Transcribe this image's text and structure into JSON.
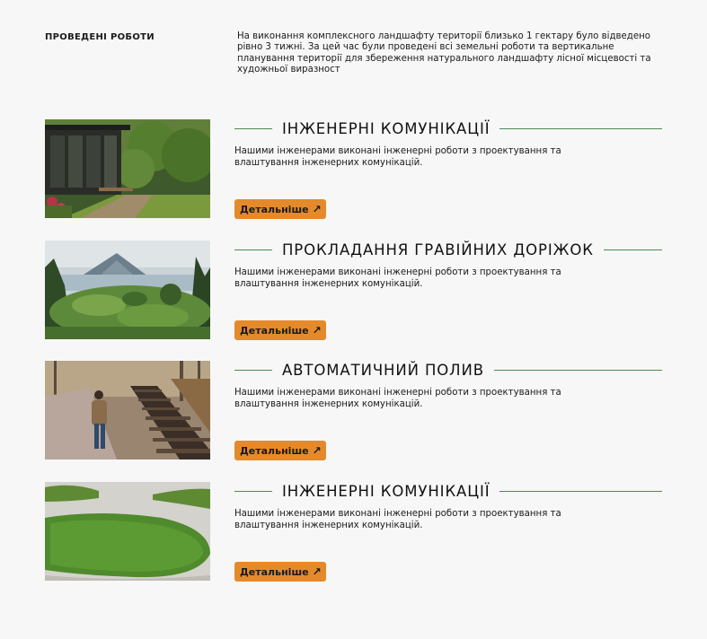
{
  "intro": {
    "title": "ПРОВЕДЕНІ РОБОТИ",
    "text": "На виконання комплексного ландшафту території близько 1 гектару було відведено рівно 3 тижні. За цей час були проведені всі земельні роботи та вертикальне планування території для збереження натурального ландшафту лісної місцевості та художньої виразност"
  },
  "cards": [
    {
      "title": "ІНЖЕНЕРНІ КОМУНІКАЦІЇ",
      "description": "Нашими інженерами виконані інженерні роботи з проектування та влаштування інженерних комунікацій.",
      "button": "Детальніше",
      "icon": "arrow-up-right-icon"
    },
    {
      "title": "ПРОКЛАДАННЯ ГРАВІЙНИХ ДОРІЖОК",
      "description": "Нашими інженерами виконані інженерні роботи з проектування та влаштування інженерних комунікацій.",
      "button": "Детальніше",
      "icon": "arrow-up-right-icon"
    },
    {
      "title": "АВТОМАТИЧНИЙ ПОЛИВ",
      "description": "Нашими інженерами виконані інженерні роботи з проектування та влаштування інженерних комунікацій.",
      "button": "Детальніше",
      "icon": "arrow-up-right-icon"
    },
    {
      "title": "ІНЖЕНЕРНІ КОМУНІКАЦІЇ",
      "description": "Нашими інженерами виконані інженерні роботи з проектування та влаштування інженерних комунікацій.",
      "button": "Детальніше",
      "icon": "arrow-up-right-icon"
    }
  ],
  "colors": {
    "background": "#f7f7f7",
    "accent_button": "#e58a2b",
    "divider_line": "#4a8a55",
    "text": "#1a1a1a"
  }
}
